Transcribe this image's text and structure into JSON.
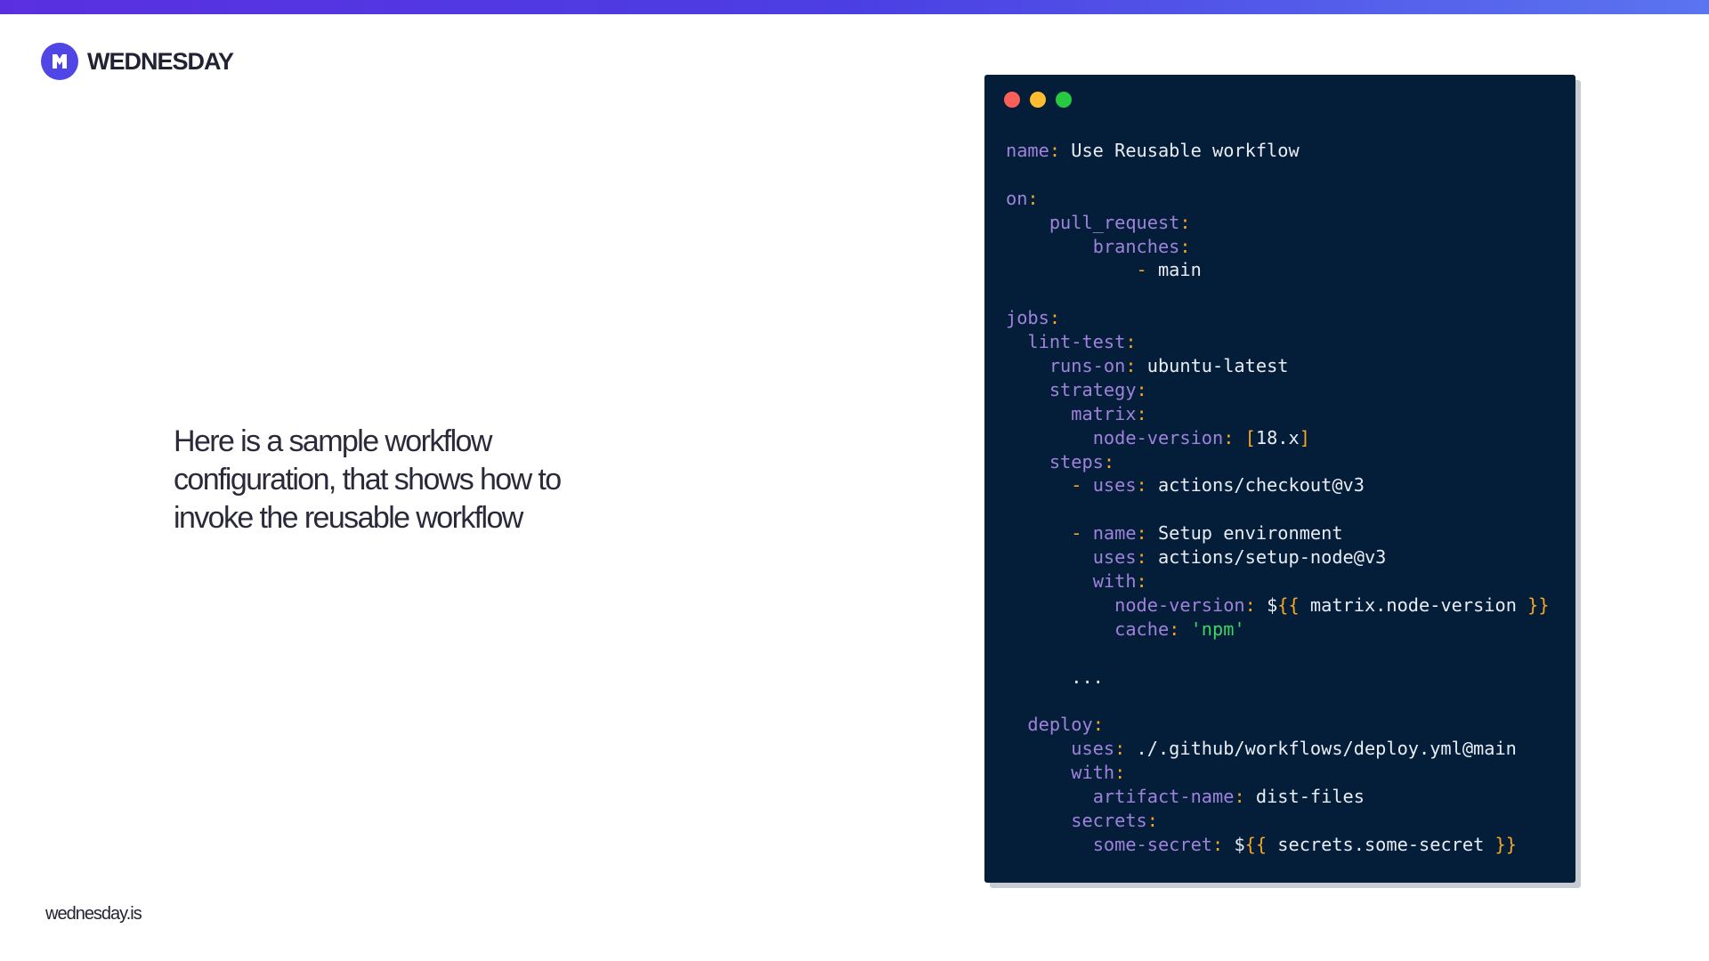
{
  "brand": {
    "name": "WEDNESDAY",
    "logo_icon": "wednesday-logo-icon",
    "logo_color": "#4f46e5"
  },
  "headline": "Here is a sample workflow configuration, that shows how to invoke the reusable workflow",
  "footer": {
    "url": "wednesday.is"
  },
  "colors": {
    "top_bar_start": "#5a2fe0",
    "top_bar_end": "#5b74f0",
    "code_background": "#041e3a",
    "code_key": "#9f82d9",
    "code_punct": "#f5a623",
    "code_string": "#3fd463"
  },
  "code_window": {
    "buttons": [
      "close",
      "minimize",
      "maximize"
    ],
    "lines": [
      [
        {
          "t": "k",
          "v": "name"
        },
        {
          "t": "p",
          "v": ": "
        },
        {
          "t": "v",
          "v": "Use Reusable workflow"
        }
      ],
      [],
      [
        {
          "t": "k",
          "v": "on"
        },
        {
          "t": "p",
          "v": ":"
        }
      ],
      [
        {
          "t": "v",
          "v": "    "
        },
        {
          "t": "k",
          "v": "pull_request"
        },
        {
          "t": "p",
          "v": ":"
        }
      ],
      [
        {
          "t": "v",
          "v": "        "
        },
        {
          "t": "k",
          "v": "branches"
        },
        {
          "t": "p",
          "v": ":"
        }
      ],
      [
        {
          "t": "v",
          "v": "            "
        },
        {
          "t": "p",
          "v": "- "
        },
        {
          "t": "v",
          "v": "main"
        }
      ],
      [],
      [
        {
          "t": "k",
          "v": "jobs"
        },
        {
          "t": "p",
          "v": ":"
        }
      ],
      [
        {
          "t": "v",
          "v": "  "
        },
        {
          "t": "k",
          "v": "lint-test"
        },
        {
          "t": "p",
          "v": ":"
        }
      ],
      [
        {
          "t": "v",
          "v": "    "
        },
        {
          "t": "k",
          "v": "runs-on"
        },
        {
          "t": "p",
          "v": ": "
        },
        {
          "t": "v",
          "v": "ubuntu-latest"
        }
      ],
      [
        {
          "t": "v",
          "v": "    "
        },
        {
          "t": "k",
          "v": "strategy"
        },
        {
          "t": "p",
          "v": ":"
        }
      ],
      [
        {
          "t": "v",
          "v": "      "
        },
        {
          "t": "k",
          "v": "matrix"
        },
        {
          "t": "p",
          "v": ":"
        }
      ],
      [
        {
          "t": "v",
          "v": "        "
        },
        {
          "t": "k",
          "v": "node-version"
        },
        {
          "t": "p",
          "v": ": ["
        },
        {
          "t": "v",
          "v": "18.x"
        },
        {
          "t": "p",
          "v": "]"
        }
      ],
      [
        {
          "t": "v",
          "v": "    "
        },
        {
          "t": "k",
          "v": "steps"
        },
        {
          "t": "p",
          "v": ":"
        }
      ],
      [
        {
          "t": "v",
          "v": "      "
        },
        {
          "t": "p",
          "v": "- "
        },
        {
          "t": "k",
          "v": "uses"
        },
        {
          "t": "p",
          "v": ": "
        },
        {
          "t": "v",
          "v": "actions/checkout@v3"
        }
      ],
      [],
      [
        {
          "t": "v",
          "v": "      "
        },
        {
          "t": "p",
          "v": "- "
        },
        {
          "t": "k",
          "v": "name"
        },
        {
          "t": "p",
          "v": ": "
        },
        {
          "t": "v",
          "v": "Setup environment"
        }
      ],
      [
        {
          "t": "v",
          "v": "        "
        },
        {
          "t": "k",
          "v": "uses"
        },
        {
          "t": "p",
          "v": ": "
        },
        {
          "t": "v",
          "v": "actions/setup-node@v3"
        }
      ],
      [
        {
          "t": "v",
          "v": "        "
        },
        {
          "t": "k",
          "v": "with"
        },
        {
          "t": "p",
          "v": ":"
        }
      ],
      [
        {
          "t": "v",
          "v": "          "
        },
        {
          "t": "k",
          "v": "node-version"
        },
        {
          "t": "p",
          "v": ": "
        },
        {
          "t": "v",
          "v": "$"
        },
        {
          "t": "p",
          "v": "{{"
        },
        {
          "t": "v",
          "v": " matrix.node-version "
        },
        {
          "t": "p",
          "v": "}}"
        }
      ],
      [
        {
          "t": "v",
          "v": "          "
        },
        {
          "t": "k",
          "v": "cache"
        },
        {
          "t": "p",
          "v": ": "
        },
        {
          "t": "s",
          "v": "'npm'"
        }
      ],
      [],
      [
        {
          "t": "v",
          "v": "      ..."
        }
      ],
      [],
      [
        {
          "t": "v",
          "v": "  "
        },
        {
          "t": "k",
          "v": "deploy"
        },
        {
          "t": "p",
          "v": ":"
        }
      ],
      [
        {
          "t": "v",
          "v": "      "
        },
        {
          "t": "k",
          "v": "uses"
        },
        {
          "t": "p",
          "v": ": "
        },
        {
          "t": "v",
          "v": "./.github/workflows/deploy.yml@main"
        }
      ],
      [
        {
          "t": "v",
          "v": "      "
        },
        {
          "t": "k",
          "v": "with"
        },
        {
          "t": "p",
          "v": ":"
        }
      ],
      [
        {
          "t": "v",
          "v": "        "
        },
        {
          "t": "k",
          "v": "artifact-name"
        },
        {
          "t": "p",
          "v": ": "
        },
        {
          "t": "v",
          "v": "dist-files"
        }
      ],
      [
        {
          "t": "v",
          "v": "      "
        },
        {
          "t": "k",
          "v": "secrets"
        },
        {
          "t": "p",
          "v": ":"
        }
      ],
      [
        {
          "t": "v",
          "v": "        "
        },
        {
          "t": "k",
          "v": "some-secret"
        },
        {
          "t": "p",
          "v": ": "
        },
        {
          "t": "v",
          "v": "$"
        },
        {
          "t": "p",
          "v": "{{"
        },
        {
          "t": "v",
          "v": " secrets.some-secret "
        },
        {
          "t": "p",
          "v": "}}"
        }
      ]
    ]
  }
}
